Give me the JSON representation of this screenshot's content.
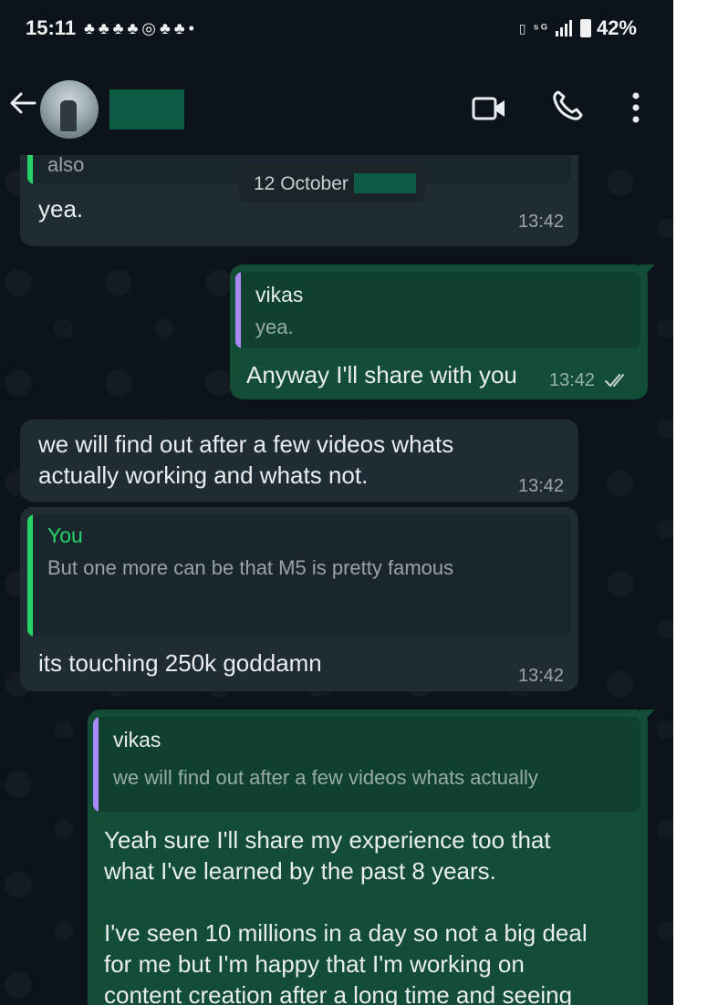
{
  "status_bar": {
    "time": "15:11",
    "notification_icons": [
      "snapchat-icon",
      "snapchat-icon",
      "snapchat-icon",
      "snapchat-icon",
      "instagram-icon",
      "snapchat-icon",
      "snapchat-icon",
      "dot-icon"
    ],
    "notification_glyphs": "♣♣♣♣◎♣♣•",
    "signal_icons": "▯ ⁵ᴳ",
    "network": "5G",
    "battery": "42%"
  },
  "header": {
    "contact_name": "",
    "icons": [
      "back-arrow-icon",
      "video-call-icon",
      "phone-icon",
      "more-vert-icon"
    ]
  },
  "date_chip": {
    "label": "12 October"
  },
  "messages": [
    {
      "dir": "in",
      "quote_text": "also",
      "text": "yea.",
      "time": "13:42"
    },
    {
      "dir": "out",
      "quote_author": "vikas",
      "quote_text": "yea.",
      "text": "Anyway I'll share with you",
      "time": "13:42",
      "status": "read-ticks"
    },
    {
      "dir": "in",
      "text_lines": [
        "we will find out after a few videos whats",
        "actually working and whats not."
      ],
      "time": "13:42"
    },
    {
      "dir": "in",
      "quote_author": "You",
      "quote_text": "But one more can be that M5 is pretty famous",
      "text": "its touching 250k goddamn",
      "time": "13:42"
    },
    {
      "dir": "out",
      "quote_author": "vikas",
      "quote_text": "we will find out after a few videos whats actually",
      "text_lines": [
        "Yeah sure I'll share my experience too that",
        "what I've learned by the past 8 years."
      ],
      "text2_lines": [
        "I've seen 10 millions in a day so not a big deal",
        "for me but I'm happy that I'm working on",
        "content creation after a long time and seeing"
      ]
    }
  ],
  "colors": {
    "background": "#0b141a",
    "incoming_bubble": "#1f2c34",
    "outgoing_bubble": "#144d37",
    "you_quote_accent": "#25d366",
    "vikas_quote_accent": "#a78bfa",
    "redaction": "#0d5c44",
    "read_ticks": "#c8d8d0"
  }
}
